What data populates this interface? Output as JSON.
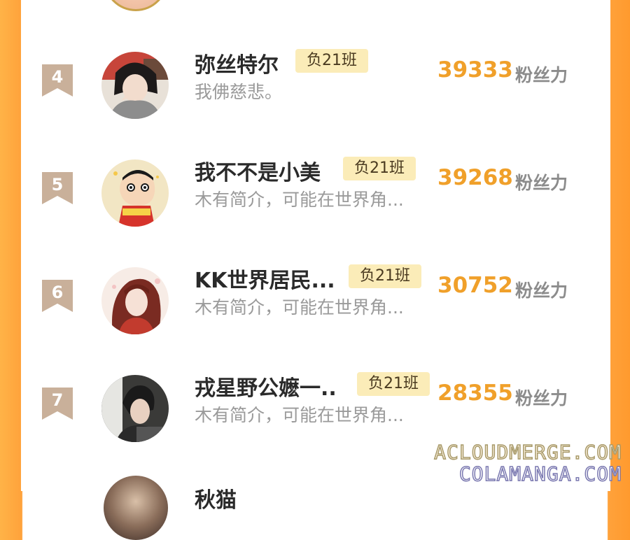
{
  "leaderboard": {
    "score_unit": "粉丝力",
    "badge_label": "负21班",
    "entries": [
      {
        "rank": "4",
        "name": "弥丝特尔",
        "desc": "我佛慈悲。",
        "score": "39333"
      },
      {
        "rank": "5",
        "name": "我不不是小美",
        "desc": "木有简介，可能在世界角...",
        "score": "39268"
      },
      {
        "rank": "6",
        "name": "KK世界居民...",
        "desc": "木有简介，可能在世界角...",
        "score": "30752"
      },
      {
        "rank": "7",
        "name": "戎星野公嬷一..",
        "desc": "木有简介，可能在世界角...",
        "score": "28355"
      }
    ],
    "partial_next_name": "秋猫"
  },
  "watermark": {
    "line1": "ACLOUDMERGE.COM",
    "line2": "COLAMANGA.COM"
  },
  "colors": {
    "accent": "#f0a02a",
    "badge_bg": "#fbecb8",
    "rank_flag": "#c9b09a",
    "frame": "#ffa23b"
  }
}
